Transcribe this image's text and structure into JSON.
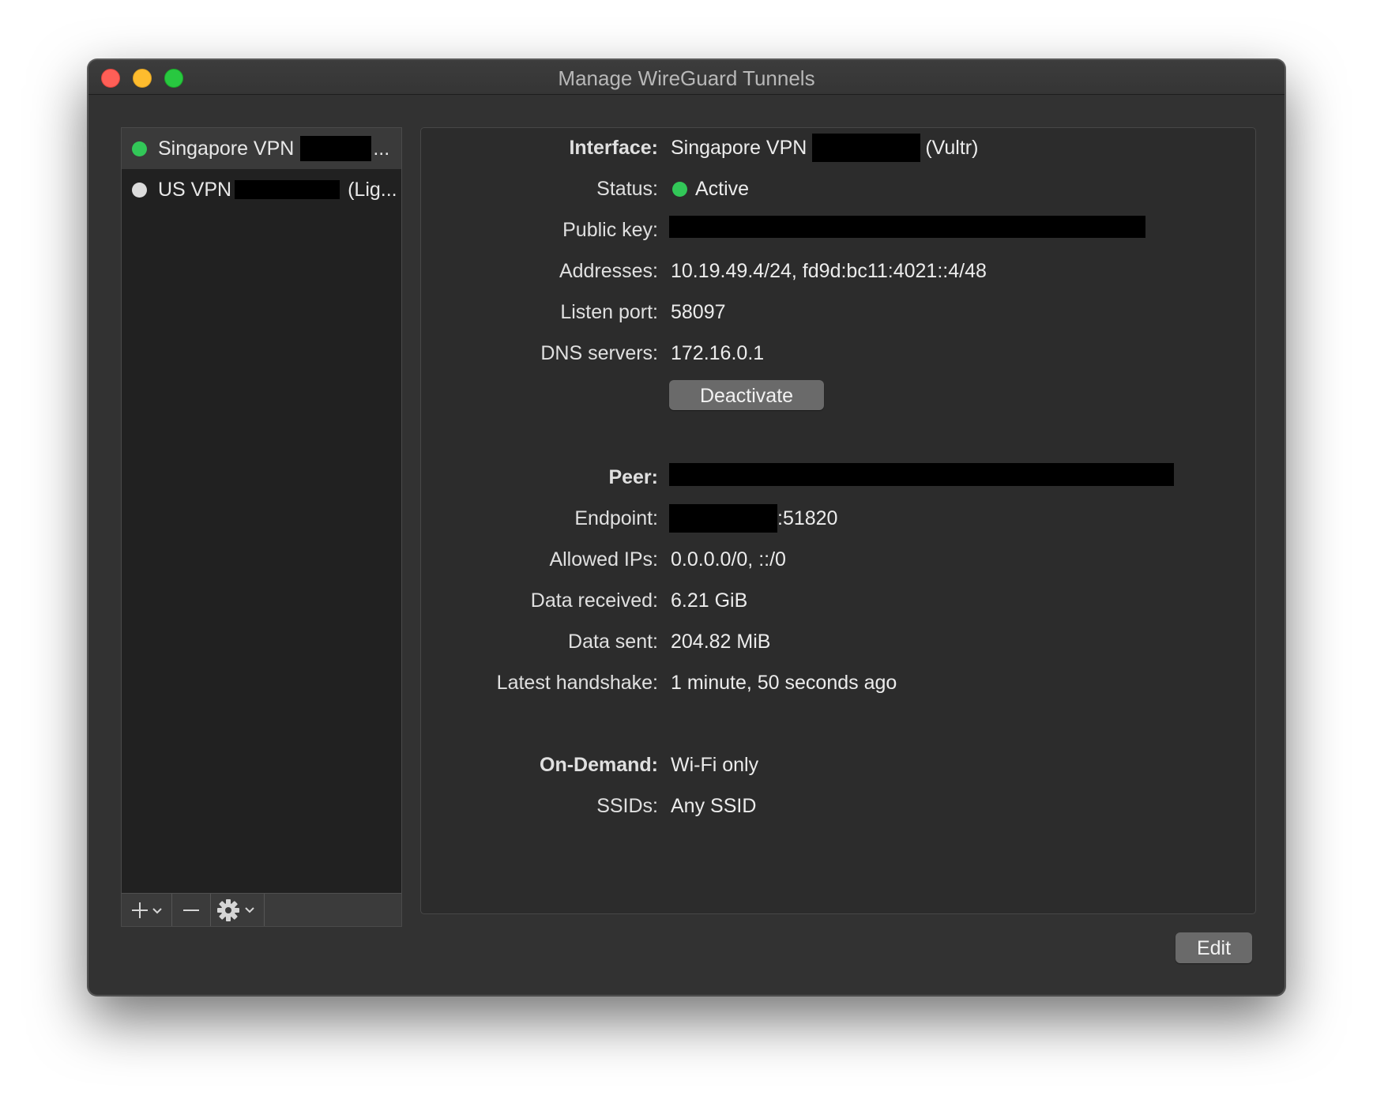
{
  "window": {
    "title": "Manage WireGuard Tunnels"
  },
  "sidebar": {
    "tunnels": [
      {
        "name": "Singapore VPN",
        "suffix": "...",
        "status": "active",
        "dot_color": "#32c758"
      },
      {
        "name": "US VPN",
        "suffix": "(Lig...",
        "status": "inactive",
        "dot_color": "#dcdcdc"
      }
    ],
    "toolbar": {
      "add_icon": "plus-icon",
      "remove_icon": "minus-icon",
      "action_icon": "gear-icon"
    }
  },
  "interface": {
    "label": "Interface:",
    "name": "Singapore VPN",
    "provider": "(Vultr)",
    "status_label": "Status:",
    "status": "Active",
    "public_key_label": "Public key:",
    "addresses_label": "Addresses:",
    "addresses": "10.19.49.4/24, fd9d:bc11:4021::4/48",
    "listen_port_label": "Listen port:",
    "listen_port": "58097",
    "dns_label": "DNS servers:",
    "dns": "172.16.0.1",
    "deactivate_button": "Deactivate"
  },
  "peer": {
    "label": "Peer:",
    "endpoint_label": "Endpoint:",
    "endpoint_port": ":51820",
    "allowed_ips_label": "Allowed IPs:",
    "allowed_ips": "0.0.0.0/0, ::/0",
    "data_received_label": "Data received:",
    "data_received": "6.21 GiB",
    "data_sent_label": "Data sent:",
    "data_sent": "204.82 MiB",
    "handshake_label": "Latest handshake:",
    "handshake": "1 minute, 50 seconds ago"
  },
  "on_demand": {
    "label": "On-Demand:",
    "value": "Wi-Fi only",
    "ssids_label": "SSIDs:",
    "ssids": "Any SSID"
  },
  "footer": {
    "edit_button": "Edit"
  },
  "colors": {
    "active_green": "#32c758",
    "redaction": "#000000"
  }
}
